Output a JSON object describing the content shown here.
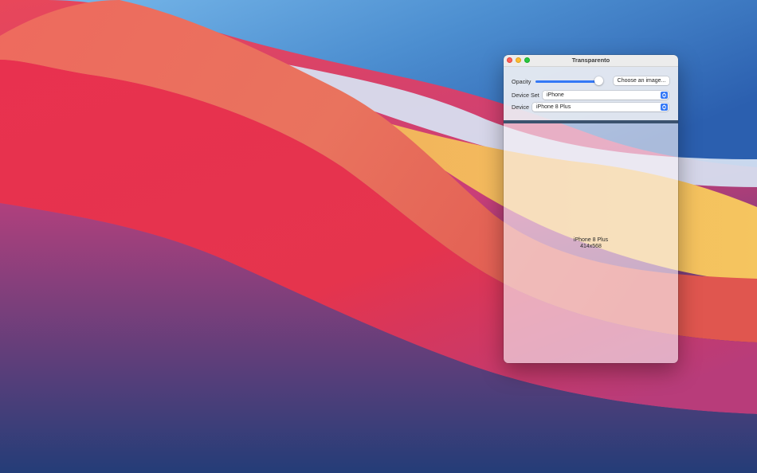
{
  "window": {
    "title": "Transparento"
  },
  "controls": {
    "opacity_label": "Opacity",
    "opacity_value": 0.97,
    "choose_image_label": "Choose an image...",
    "device_set_label": "Device Set",
    "device_set_value": "iPhone",
    "device_label": "Device",
    "device_value": "iPhone 8 Plus"
  },
  "preview": {
    "device_name": "iPhone 8 Plus",
    "device_size": "414x568"
  },
  "colors": {
    "accent": "#3478f6",
    "close": "#fe5f57",
    "minimize": "#febc2e",
    "zoom": "#28c840"
  },
  "icons": {
    "popup": "chevron-up-down-icon"
  }
}
